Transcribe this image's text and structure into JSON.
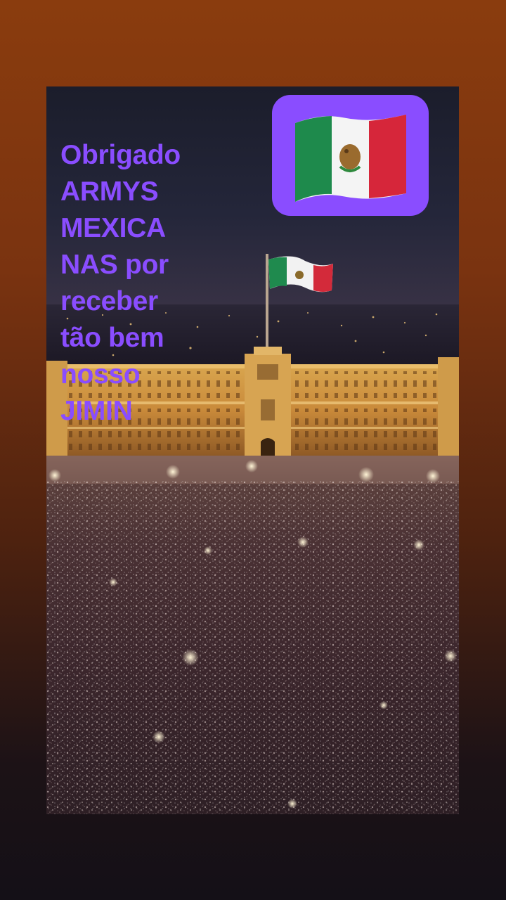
{
  "story": {
    "caption_lines": [
      "Obrigado",
      "ARMYS",
      "MEXICA",
      "NAS por",
      "receber",
      "tão bem",
      "nosso",
      "JIMIN"
    ],
    "sticker_emoji": "flag-mexico-emoji",
    "photo_subject": "crowd-with-lights-plaza-palace"
  },
  "colors": {
    "caption": "#8a4dff",
    "sticker_background": "#8a4dff",
    "flag_green": "#1e8a4c",
    "flag_white": "#f4f4f4",
    "flag_red": "#d6263a"
  }
}
